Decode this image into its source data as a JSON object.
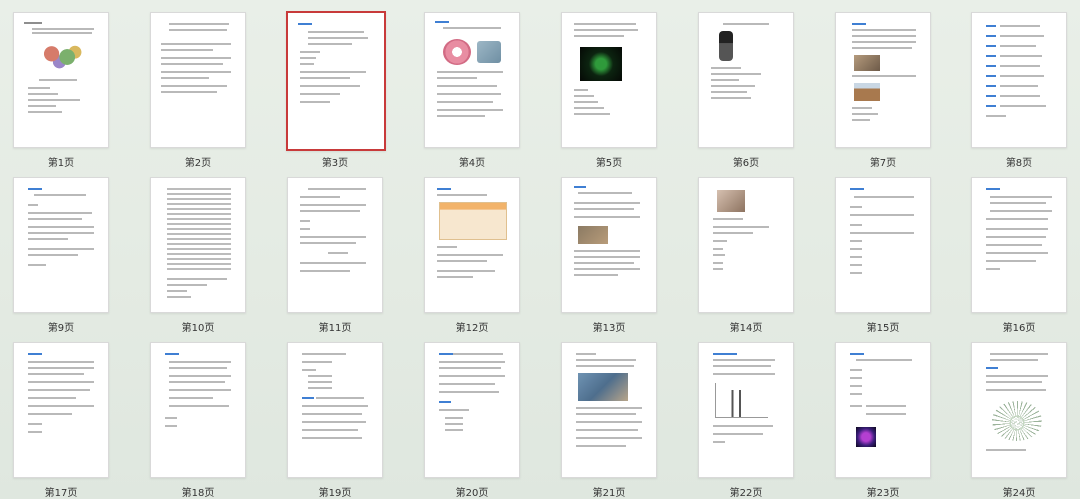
{
  "pages": [
    {
      "label": "第1页"
    },
    {
      "label": "第2页"
    },
    {
      "label": "第3页",
      "selected": true
    },
    {
      "label": "第4页"
    },
    {
      "label": "第5页"
    },
    {
      "label": "第6页"
    },
    {
      "label": "第7页"
    },
    {
      "label": "第8页"
    },
    {
      "label": "第9页"
    },
    {
      "label": "第10页"
    },
    {
      "label": "第11页"
    },
    {
      "label": "第12页"
    },
    {
      "label": "第13页"
    },
    {
      "label": "第14页"
    },
    {
      "label": "第15页"
    },
    {
      "label": "第16页"
    },
    {
      "label": "第17页"
    },
    {
      "label": "第18页"
    },
    {
      "label": "第19页"
    },
    {
      "label": "第20页"
    },
    {
      "label": "第21页"
    },
    {
      "label": "第22页"
    },
    {
      "label": "第23页"
    },
    {
      "label": "第24页"
    }
  ],
  "colors": {
    "selected_border": "#c83a3a",
    "link_text": "#3f7fd3"
  }
}
